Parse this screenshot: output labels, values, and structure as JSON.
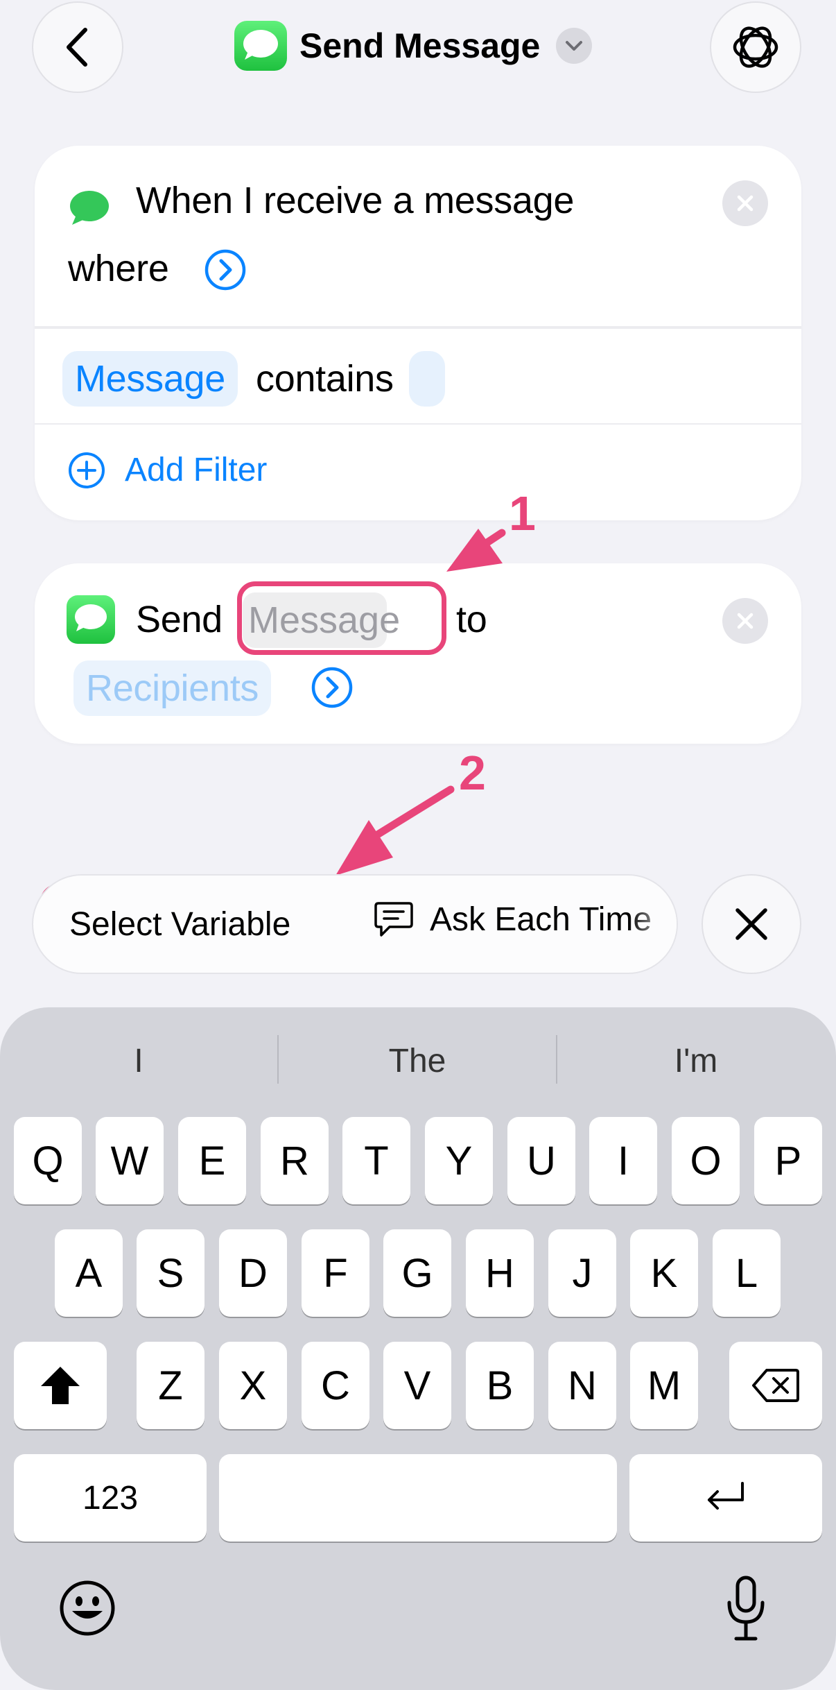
{
  "header": {
    "title": "Send Message"
  },
  "trigger_card": {
    "line1": "When I receive a message",
    "line2": "where",
    "filter": {
      "field": "Message",
      "operator": "contains"
    },
    "add_filter_label": "Add Filter"
  },
  "action_card": {
    "verb": "Send",
    "message_placeholder": "Message",
    "connector": "to",
    "recipients_placeholder": "Recipients"
  },
  "annotations": {
    "step1": "1",
    "step2": "2",
    "highlight_color": "#e8457a"
  },
  "input_bar": {
    "select_variable_label": "Select Variable",
    "ask_each_time_label": "Ask Each Time"
  },
  "keyboard": {
    "suggestions": [
      "I",
      "The",
      "I'm"
    ],
    "row1": [
      "Q",
      "W",
      "E",
      "R",
      "T",
      "Y",
      "U",
      "I",
      "O",
      "P"
    ],
    "row2": [
      "A",
      "S",
      "D",
      "F",
      "G",
      "H",
      "J",
      "K",
      "L"
    ],
    "row3": [
      "Z",
      "X",
      "C",
      "V",
      "B",
      "N",
      "M"
    ],
    "numbers_label": "123"
  },
  "colors": {
    "accent": "#0a84ff",
    "messages_green": "#34c759",
    "background": "#f2f2f7"
  }
}
